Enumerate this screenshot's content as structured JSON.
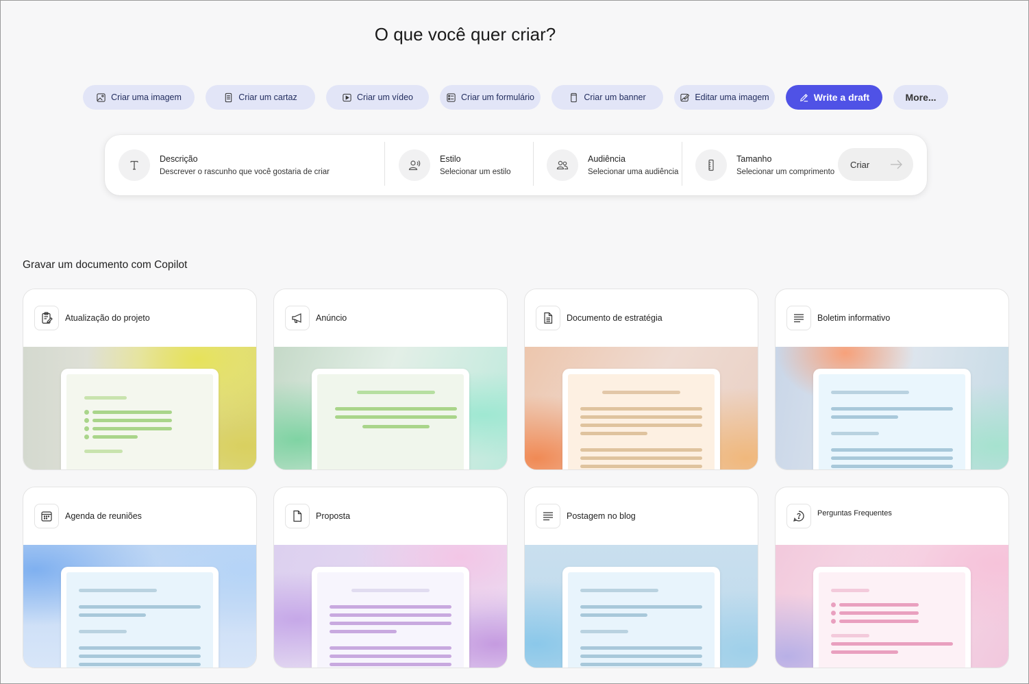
{
  "page": {
    "title": "O que você quer criar?"
  },
  "chips": [
    {
      "label": "Criar uma imagem",
      "icon": "image-icon"
    },
    {
      "label": "Criar um cartaz",
      "icon": "poster-icon"
    },
    {
      "label": "Criar um vídeo",
      "icon": "video-icon"
    },
    {
      "label": "Criar um formulário",
      "icon": "form-icon"
    },
    {
      "label": "Criar um banner",
      "icon": "banner-icon"
    },
    {
      "label": "Editar uma imagem",
      "icon": "edit-image-icon"
    },
    {
      "label": "Write a draft",
      "icon": "pen-icon",
      "selected": true
    },
    {
      "label": "More..."
    }
  ],
  "prompt": {
    "description": {
      "label": "Descrição",
      "value": "Descrever o rascunho que você gostaria de criar",
      "icon": "text-icon"
    },
    "style": {
      "label": "Estilo",
      "value": "Selecionar um estilo",
      "icon": "voice-icon"
    },
    "audience": {
      "label": "Audiência",
      "value": "Selecionar uma audiência",
      "icon": "people-icon"
    },
    "size": {
      "label": "Tamanho",
      "value": "Selecionar um comprimento",
      "icon": "ruler-icon"
    },
    "create_label": "Criar"
  },
  "section": {
    "title": "Gravar um documento com Copilot"
  },
  "cards": [
    {
      "label": "Atualização do projeto",
      "icon": "clipboard-edit-icon"
    },
    {
      "label": "Anúncio",
      "icon": "megaphone-icon"
    },
    {
      "label": "Documento de estratégia",
      "icon": "document-text-icon"
    },
    {
      "label": "Boletim informativo",
      "icon": "text-align-icon"
    },
    {
      "label": "Agenda de reuniões",
      "icon": "calendar-icon"
    },
    {
      "label": "Proposta",
      "icon": "document-icon"
    },
    {
      "label": "Postagem no blog",
      "icon": "text-align-icon"
    },
    {
      "label": "Perguntas Frequentes",
      "icon": "chat-question-icon"
    }
  ],
  "colors": {
    "accent": "#4f52e6",
    "chip_bg": "#e2e5f7"
  }
}
